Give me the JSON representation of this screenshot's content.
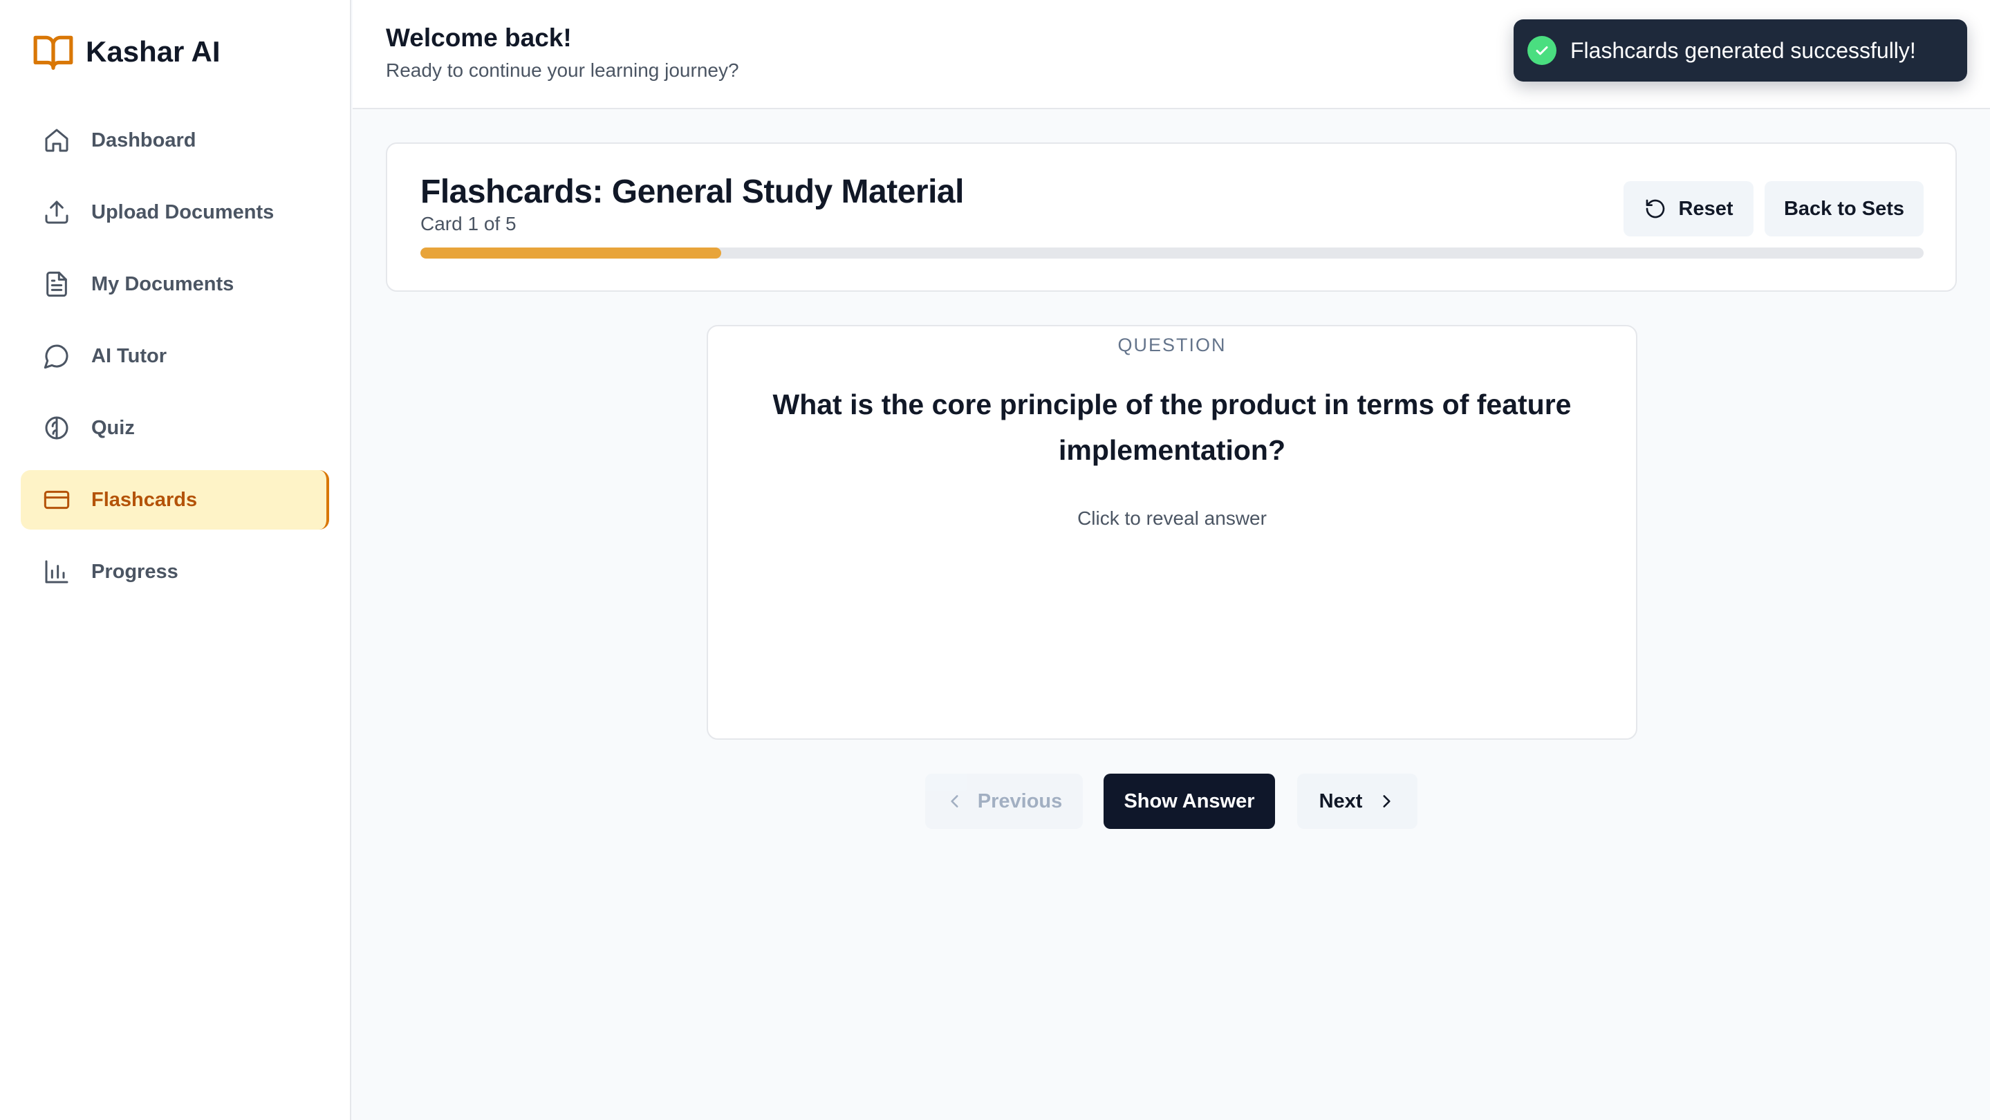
{
  "brand": {
    "name": "Kashar AI",
    "icon": "open-book-icon",
    "accent": "#d97706"
  },
  "sidebar": {
    "items": [
      {
        "label": "Dashboard",
        "icon": "home-icon",
        "active": false
      },
      {
        "label": "Upload Documents",
        "icon": "upload-icon",
        "active": false
      },
      {
        "label": "My Documents",
        "icon": "document-icon",
        "active": false
      },
      {
        "label": "AI Tutor",
        "icon": "chat-bubble-icon",
        "active": false
      },
      {
        "label": "Quiz",
        "icon": "brain-icon",
        "active": false
      },
      {
        "label": "Flashcards",
        "icon": "card-icon",
        "active": true
      },
      {
        "label": "Progress",
        "icon": "bar-chart-icon",
        "active": false
      }
    ]
  },
  "header": {
    "title": "Welcome back!",
    "subtitle": "Ready to continue your learning journey?"
  },
  "toast": {
    "message": "Flashcards generated successfully!",
    "icon": "check-circle-icon",
    "color": "#4ade80"
  },
  "flashcards": {
    "title": "Flashcards: General Study Material",
    "counter": "Card 1 of 5",
    "progress": 0.2,
    "reset_label": "Reset",
    "back_label": "Back to Sets",
    "card": {
      "label": "QUESTION",
      "question": "What is the core principle of the product in terms of feature implementation?",
      "hint": "Click to reveal answer"
    },
    "nav": {
      "previous_label": "Previous",
      "show_answer_label": "Show Answer",
      "next_label": "Next"
    }
  }
}
